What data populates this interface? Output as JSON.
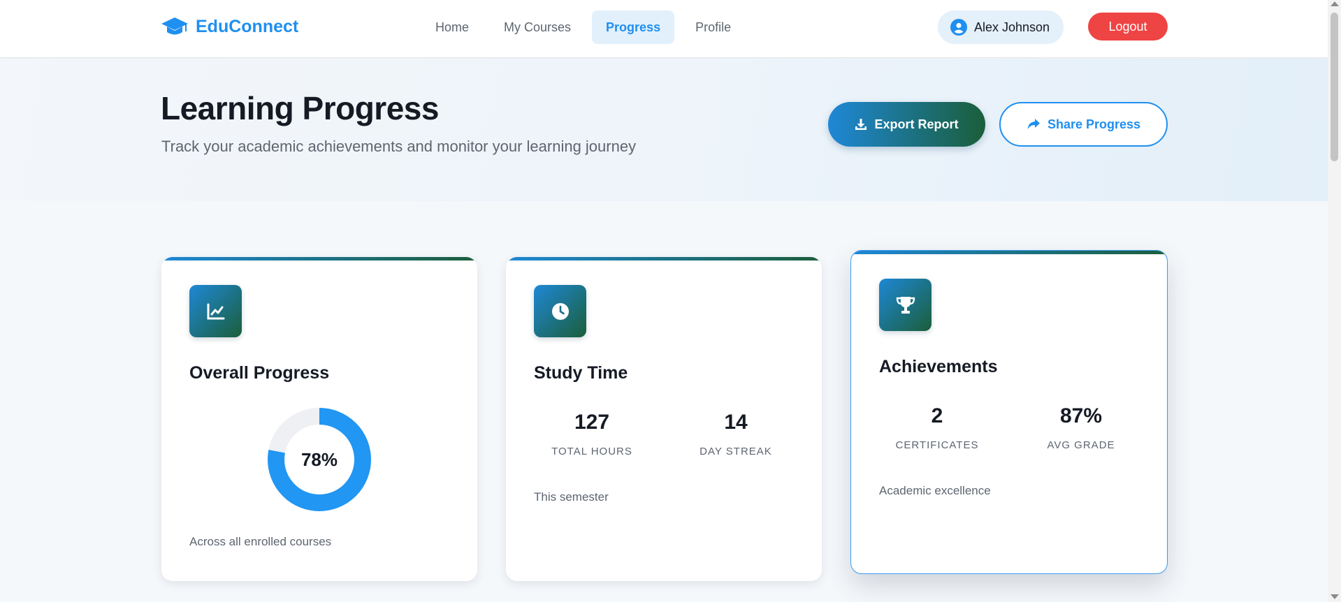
{
  "brand": {
    "name": "EduConnect",
    "icon": "graduation-cap-icon",
    "color": "#1f8ff0"
  },
  "nav": {
    "items": [
      {
        "label": "Home",
        "active": false
      },
      {
        "label": "My Courses",
        "active": false
      },
      {
        "label": "Progress",
        "active": true
      },
      {
        "label": "Profile",
        "active": false
      }
    ]
  },
  "user": {
    "name": "Alex Johnson",
    "icon": "user-circle-icon"
  },
  "logout_label": "Logout",
  "hero": {
    "title": "Learning Progress",
    "subtitle": "Track your academic achievements and monitor your learning journey",
    "export_label": "Export Report",
    "share_label": "Share Progress"
  },
  "cards": {
    "overall": {
      "title": "Overall Progress",
      "icon": "line-chart-icon",
      "percent": 78,
      "percent_label": "78%",
      "note": "Across all enrolled courses"
    },
    "study": {
      "title": "Study Time",
      "icon": "clock-icon",
      "stats": [
        {
          "value": "127",
          "label": "TOTAL HOURS"
        },
        {
          "value": "14",
          "label": "DAY STREAK"
        }
      ],
      "note": "This semester"
    },
    "achievements": {
      "title": "Achievements",
      "icon": "trophy-icon",
      "stats": [
        {
          "value": "2",
          "label": "CERTIFICATES"
        },
        {
          "value": "87%",
          "label": "AVG GRADE"
        }
      ],
      "note": "Academic excellence"
    }
  },
  "colors": {
    "accent": "#1f8ff0",
    "gradient_start": "#1e88d6",
    "gradient_end": "#1b5e3a",
    "danger": "#ef4444",
    "donut_track": "#eef0f3"
  }
}
